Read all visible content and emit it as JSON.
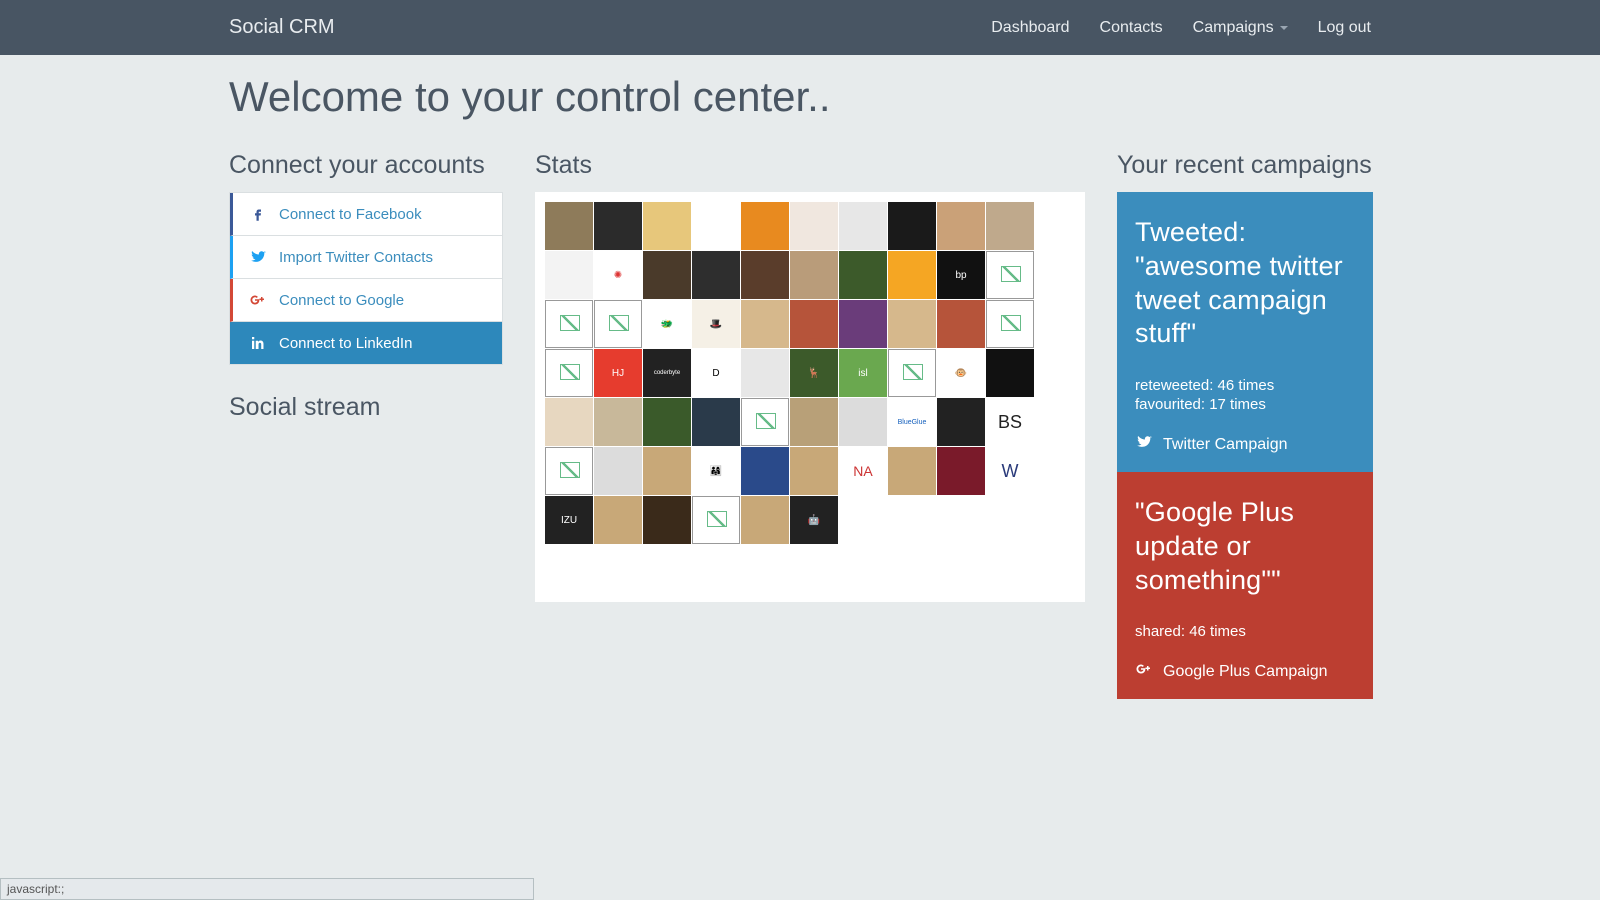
{
  "nav": {
    "brand": "Social CRM",
    "links": {
      "dashboard": "Dashboard",
      "contacts": "Contacts",
      "campaigns": "Campaigns",
      "logout": "Log out"
    }
  },
  "page_title": "Welcome to your control center..",
  "sidebar": {
    "connect_heading": "Connect your accounts",
    "items": {
      "facebook": "Connect to Facebook",
      "twitter": "Import Twitter Contacts",
      "google": "Connect to Google",
      "linkedin": "Connect to LinkedIn"
    },
    "stream_heading": "Social stream"
  },
  "stats": {
    "heading": "Stats",
    "avatar_count": 60,
    "avatars": [
      {
        "bg": "#8e7b5a"
      },
      {
        "bg": "#2b2b2b"
      },
      {
        "bg": "#e7c77b"
      },
      {
        "bg": "#ffffff",
        "fg": "#3a9a3a",
        "text": ""
      },
      {
        "bg": "#e88a1f"
      },
      {
        "bg": "#f0e7df"
      },
      {
        "bg": "#e7e7e7"
      },
      {
        "bg": "#1a1a1a"
      },
      {
        "bg": "#caa178"
      },
      {
        "bg": "#bfa98c"
      },
      {
        "bg": "#f3f3f3"
      },
      {
        "bg": "#ffffff",
        "fg": "#d33",
        "text": "✺"
      },
      {
        "bg": "#4a3a2a"
      },
      {
        "bg": "#2e2e2e"
      },
      {
        "bg": "#5a3d2b"
      },
      {
        "bg": "#b99c7a"
      },
      {
        "bg": "#3c5a2a"
      },
      {
        "bg": "#f5a623"
      },
      {
        "bg": "#111",
        "text": "bp"
      },
      {
        "broken": true
      },
      {
        "broken": true
      },
      {
        "broken": true
      },
      {
        "bg": "#ffffff",
        "fg": "#0a0",
        "text": "🐲"
      },
      {
        "bg": "#f5f0e6",
        "fg": "#222",
        "text": "🎩"
      },
      {
        "bg": "#d6b88c"
      },
      {
        "bg": "#b6543a"
      },
      {
        "bg": "#6a3c7a"
      },
      {
        "bg": "#d6b88c"
      },
      {
        "bg": "#b6543a"
      },
      {
        "broken": true
      },
      {
        "broken": true
      },
      {
        "bg": "#e63c2e",
        "text": "HJ"
      },
      {
        "bg": "#222",
        "text": "coderbyte",
        "fs": "6"
      },
      {
        "bg": "#fff",
        "fg": "#000",
        "text": "D"
      },
      {
        "bg": "#e7e7e7"
      },
      {
        "bg": "#3c5a2a",
        "text": "🦌"
      },
      {
        "bg": "#6aa84f",
        "text": "isl"
      },
      {
        "broken": true
      },
      {
        "bg": "#fff",
        "fg": "#c33",
        "text": "🐵"
      },
      {
        "bg": "#111"
      },
      {
        "bg": "#e7d7c0"
      },
      {
        "bg": "#c8b89a"
      },
      {
        "bg": "#3a5a2a"
      },
      {
        "bg": "#2a3a4a"
      },
      {
        "broken": true
      },
      {
        "bg": "#b8a078"
      },
      {
        "bg": "#dcdcdc"
      },
      {
        "bg": "#fff",
        "fg": "#1560bd",
        "text": "BlueGlue",
        "fs": "7"
      },
      {
        "bg": "#222"
      },
      {
        "bg": "#fff",
        "fg": "#222",
        "text": "BS",
        "fs": "18"
      },
      {
        "broken": true
      },
      {
        "bg": "#dcdcdc"
      },
      {
        "bg": "#c8a878"
      },
      {
        "bg": "#fff",
        "text": "👨‍👩‍👧"
      },
      {
        "bg": "#2a4a8a"
      },
      {
        "bg": "#c8a878"
      },
      {
        "bg": "#fff",
        "fg": "#c33",
        "text": "NA",
        "fs": "14"
      },
      {
        "bg": "#c8a878"
      },
      {
        "bg": "#7a1a2a"
      },
      {
        "bg": "#fff",
        "fg": "#2a3a7a",
        "text": "W",
        "fs": "18"
      },
      {
        "bg": "#222",
        "text": "IZU",
        "fs": "10"
      },
      {
        "bg": "#c8a878"
      },
      {
        "bg": "#3a2a1a"
      },
      {
        "broken": true
      },
      {
        "bg": "#c8a878"
      },
      {
        "bg": "#222",
        "fg": "#6c3",
        "text": "🤖"
      }
    ]
  },
  "campaigns": {
    "heading": "Your recent campaigns",
    "twitter": {
      "headline": "Tweeted: \"awesome twitter tweet campaign stuff\"",
      "retweeted": "reteweeted: 46 times",
      "favourited": "favourited: 17 times",
      "footer": "Twitter Campaign"
    },
    "google": {
      "headline": "\"Google Plus update or something\"\"",
      "shared": "shared: 46 times",
      "footer": "Google Plus Campaign"
    }
  },
  "status_bar": "javascript:;"
}
